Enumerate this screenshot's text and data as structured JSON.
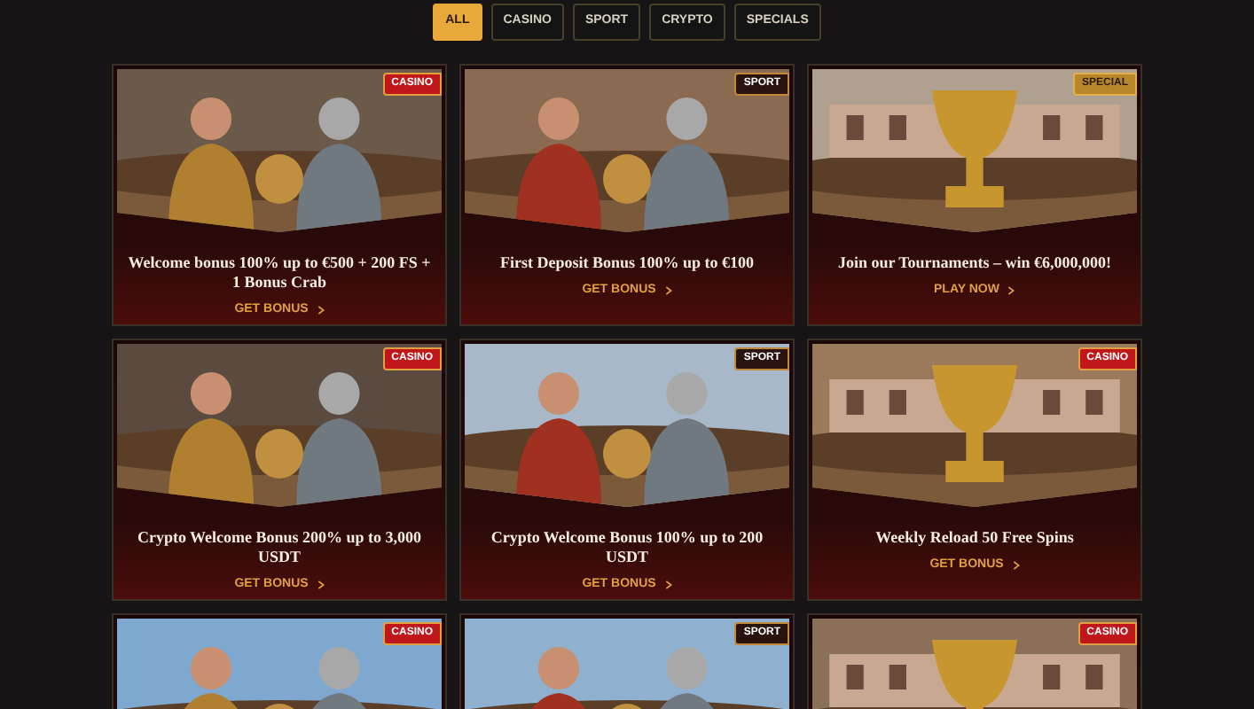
{
  "filters": [
    {
      "label": "ALL",
      "selected": true
    },
    {
      "label": "CASINO",
      "selected": false
    },
    {
      "label": "SPORT",
      "selected": false
    },
    {
      "label": "CRYPTO",
      "selected": false
    },
    {
      "label": "SPECIALS",
      "selected": false
    }
  ],
  "promotions": [
    {
      "tag": {
        "label": "CASINO",
        "kind": "casino"
      },
      "title": "Welcome bonus 100% up to €500 + 200 FS + 1 Bonus Crab",
      "cta": "GET BONUS"
    },
    {
      "tag": {
        "label": "SPORT",
        "kind": "sport"
      },
      "title": "First Deposit Bonus 100% up to €100",
      "cta": "GET BONUS"
    },
    {
      "tag": {
        "label": "SPECIAL",
        "kind": "special"
      },
      "title": "Join our Tournaments – win €6,000,000!",
      "cta": "PLAY NOW"
    },
    {
      "tag": {
        "label": "CASINO",
        "kind": "casino"
      },
      "title": "Crypto Welcome Bonus 200% up to 3,000 USDT",
      "cta": "GET BONUS"
    },
    {
      "tag": {
        "label": "SPORT",
        "kind": "sport"
      },
      "title": "Crypto Welcome Bonus 100% up to 200 USDT",
      "cta": "GET BONUS"
    },
    {
      "tag": {
        "label": "CASINO",
        "kind": "casino"
      },
      "title": "Weekly Reload 50 Free Spins",
      "cta": "GET BONUS"
    },
    {
      "tag": {
        "label": "CASINO",
        "kind": "casino"
      }
    },
    {
      "tag": {
        "label": "SPORT",
        "kind": "sport"
      }
    },
    {
      "tag": {
        "label": "CASINO",
        "kind": "casino"
      }
    }
  ]
}
